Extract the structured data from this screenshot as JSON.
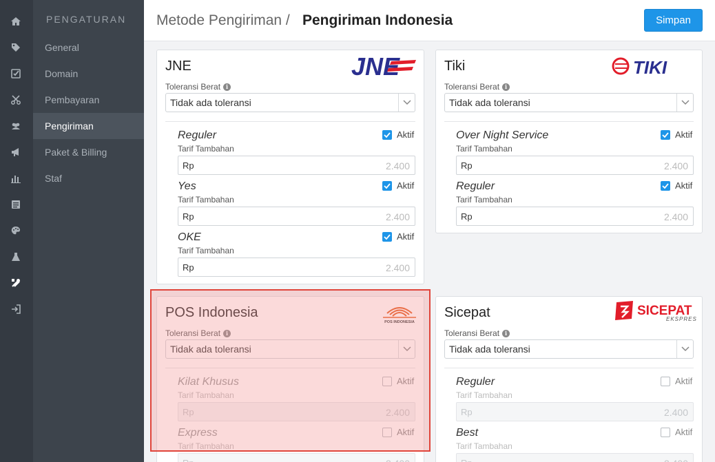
{
  "colors": {
    "accent": "#1e95e8",
    "rail": "#343a42",
    "sidenav": "#3d444c",
    "highlight": "#e0443a"
  },
  "rail_icons": [
    "home-icon",
    "tag-icon",
    "checkbox-icon",
    "scissors-icon",
    "users-icon",
    "megaphone-icon",
    "bar-chart-icon",
    "list-icon",
    "palette-icon",
    "flask-icon",
    "tools-icon",
    "sign-in-icon"
  ],
  "sidebar": {
    "heading": "PENGATURAN",
    "items": [
      {
        "label": "General"
      },
      {
        "label": "Domain"
      },
      {
        "label": "Pembayaran"
      },
      {
        "label": "Pengiriman",
        "active": true
      },
      {
        "label": "Paket & Billing"
      },
      {
        "label": "Staf"
      }
    ]
  },
  "header": {
    "breadcrumb_parent": "Metode Pengiriman /",
    "breadcrumb_current": "Pengiriman Indonesia",
    "save_label": "Simpan"
  },
  "common": {
    "tolerance_label": "Toleransi Berat",
    "tolerance_value": "Tidak ada toleransi",
    "aktif_label": "Aktif",
    "tarif_label": "Tarif Tambahan",
    "currency": "Rp",
    "tarif_placeholder": "2.400"
  },
  "logos": {
    "jne": "JNE",
    "tiki": "TIKI",
    "pos": "POS INDONESIA",
    "sicepat": "SICEPAT",
    "sicepat_sub": "EKSPRES"
  },
  "couriers": {
    "jne": {
      "name": "JNE",
      "services": [
        {
          "name": "Reguler",
          "active": true
        },
        {
          "name": "Yes",
          "active": true
        },
        {
          "name": "OKE",
          "active": true
        }
      ]
    },
    "tiki": {
      "name": "Tiki",
      "services": [
        {
          "name": "Over Night Service",
          "active": true
        },
        {
          "name": "Reguler",
          "active": true
        }
      ]
    },
    "pos": {
      "name": "POS Indonesia",
      "services": [
        {
          "name": "Kilat Khusus",
          "active": false
        },
        {
          "name": "Express",
          "active": false
        }
      ]
    },
    "sicepat": {
      "name": "Sicepat",
      "services": [
        {
          "name": "Reguler",
          "active": false
        },
        {
          "name": "Best",
          "active": false
        }
      ]
    }
  }
}
